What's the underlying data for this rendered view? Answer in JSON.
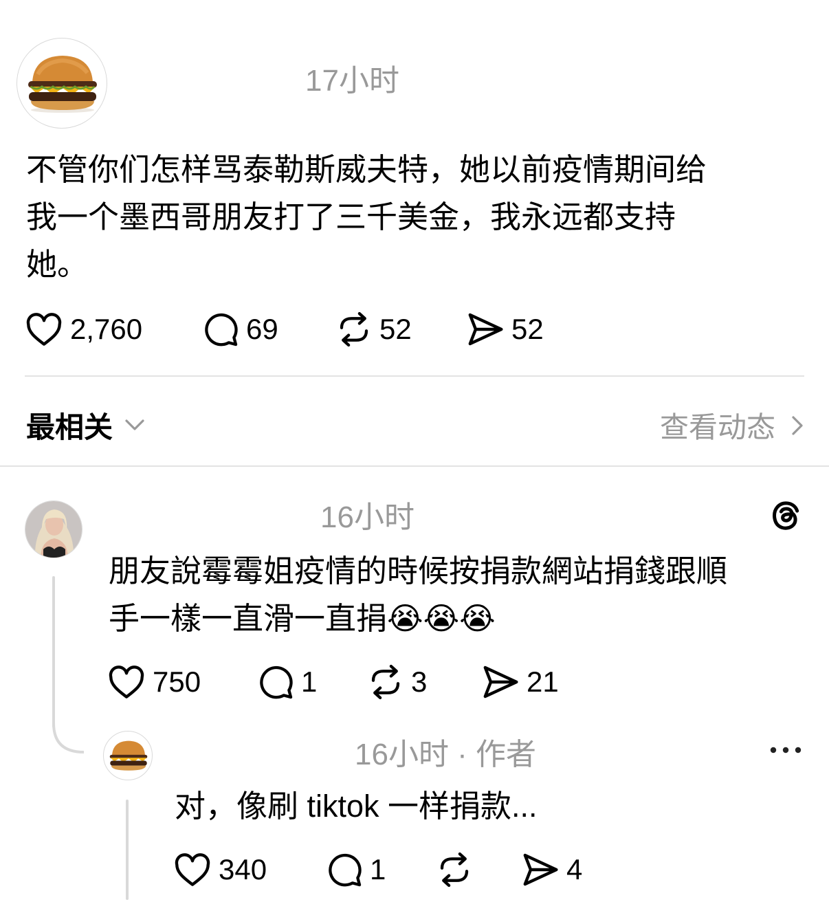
{
  "post": {
    "avatar_icon": "burger-avatar",
    "time": "17小时",
    "text_lines": [
      "不管你们怎样骂泰勒斯威夫特，她以前疫情期间给",
      "我一个墨西哥朋友打了三千美金，我永远都支持",
      "她。"
    ],
    "likes": "2,760",
    "replies": "69",
    "reposts": "52",
    "shares": "52"
  },
  "sort": {
    "label": "最相关",
    "activity_label": "查看动态"
  },
  "comment1": {
    "avatar_icon": "woman-avatar",
    "time": "16小时",
    "app_icon": "threads-icon",
    "text_lines": [
      "朋友說霉霉姐疫情的時候按捐款網站捐錢跟順",
      "手一樣一直滑一直捐😭😭😭"
    ],
    "likes": "750",
    "replies": "1",
    "reposts": "3",
    "shares": "21"
  },
  "reply1": {
    "avatar_icon": "burger-avatar",
    "time": "16小时 · 作者",
    "text": "对，像刷 tiktok 一样捐款...",
    "likes": "340",
    "replies": "1",
    "shares": "4"
  },
  "colors": {
    "secondary_text": "#999999",
    "divider": "#e3e3e3"
  }
}
